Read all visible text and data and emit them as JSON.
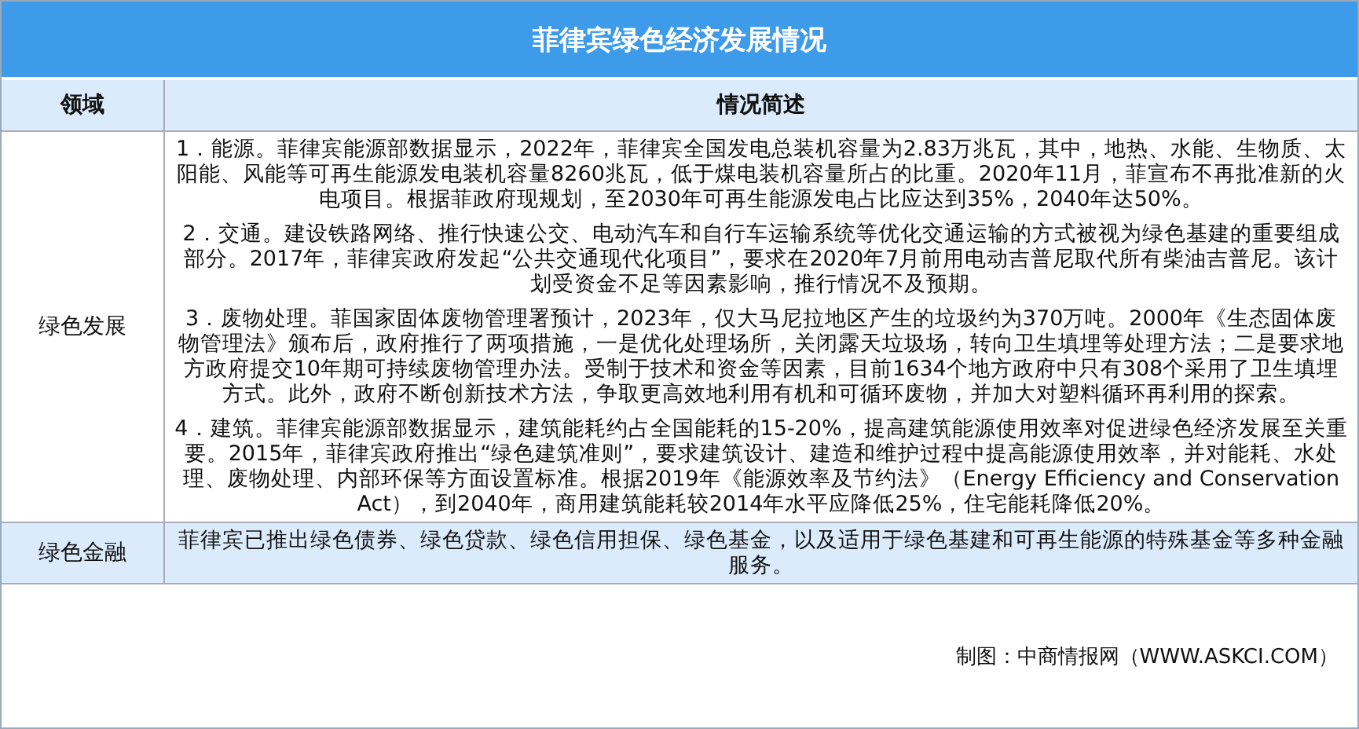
{
  "title": "菲律宾绿色经济发展情况",
  "columns": [
    "领域",
    "情况简述"
  ],
  "rows": [
    {
      "field": "绿色发展",
      "paragraphs": [
        "1．能源。菲律宾能源部数据显示，2022年，菲律宾全国发电总装机容量为2.83万兆瓦，其中，地热、水能、生物质、太阳能、风能等可再生能源发电装机容量8260兆瓦，低于煤电装机容量所占的比重。2020年11月，菲宣布不再批准新的火电项目。根据菲政府现规划，至2030年可再生能源发电占比应达到35%，2040年达50%。",
        "2．交通。建设铁路网络、推行快速公交、电动汽车和自行车运输系统等优化交通运输的方式被视为绿色基建的重要组成部分。2017年，菲律宾政府发起“公共交通现代化项目”，要求在2020年7月前用电动吉普尼取代所有柴油吉普尼。该计划受资金不足等因素影响，推行情况不及预期。",
        "3．废物处理。菲国家固体废物管理署预计，2023年，仅大马尼拉地区产生的垃圾约为370万吨。2000年《生态固体废物管理法》颁布后，政府推行了两项措施，一是优化处理场所，关闭露天垃圾场，转向卫生填埋等处理方法；二是要求地方政府提交10年期可持续废物管理办法。受制于技术和资金等因素，目前1634个地方政府中只有308个采用了卫生填埋方式。此外，政府不断创新技术方法，争取更高效地利用有机和可循环废物，并加大对塑料循环再利用的探索。",
        "4．建筑。菲律宾能源部数据显示，建筑能耗约占全国能耗的15-20%，提高建筑能源使用效率对促进绿色经济发展至关重要。2015年，菲律宾政府推出“绿色建筑准则”，要求建筑设计、建造和维护过程中提高能源使用效率，并对能耗、水处理、废物处理、内部环保等方面设置标准。根据2019年《能源效率及节约法》（Energy Efficiency and Conservation Act），到2040年，商用建筑能耗较2014年水平应降低25%，住宅能耗降低20%。"
      ]
    },
    {
      "field": "绿色金融",
      "paragraphs": [
        "菲律宾已推出绿色债券、绿色贷款、绿色信用担保、绿色基金，以及适用于绿色基建和可再生能源的特殊基金等多种金融服务。"
      ]
    }
  ],
  "source": "制图：中商情报网（WWW.ASKCI.COM）"
}
